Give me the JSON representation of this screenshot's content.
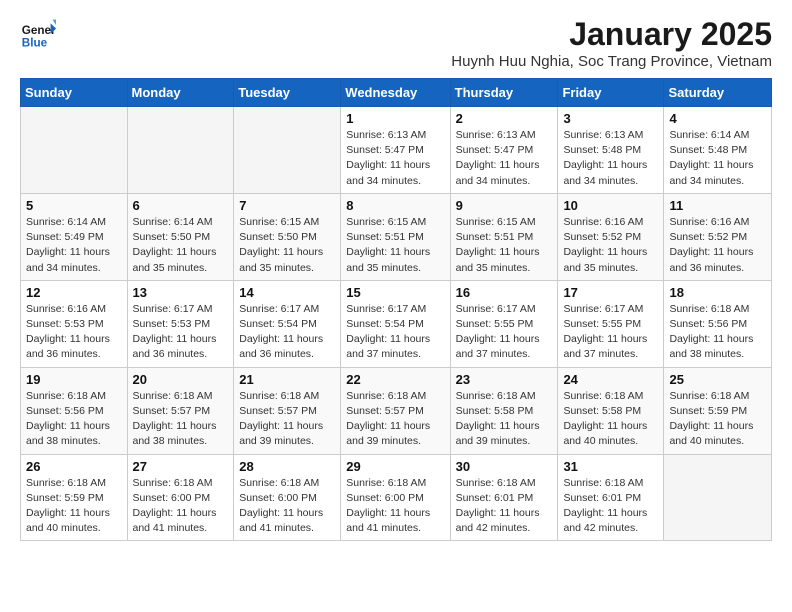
{
  "header": {
    "logo_line1": "General",
    "logo_line2": "Blue",
    "month": "January 2025",
    "location": "Huynh Huu Nghia, Soc Trang Province, Vietnam"
  },
  "days_of_week": [
    "Sunday",
    "Monday",
    "Tuesday",
    "Wednesday",
    "Thursday",
    "Friday",
    "Saturday"
  ],
  "weeks": [
    [
      {
        "day": "",
        "info": ""
      },
      {
        "day": "",
        "info": ""
      },
      {
        "day": "",
        "info": ""
      },
      {
        "day": "1",
        "info": "Sunrise: 6:13 AM\nSunset: 5:47 PM\nDaylight: 11 hours and 34 minutes."
      },
      {
        "day": "2",
        "info": "Sunrise: 6:13 AM\nSunset: 5:47 PM\nDaylight: 11 hours and 34 minutes."
      },
      {
        "day": "3",
        "info": "Sunrise: 6:13 AM\nSunset: 5:48 PM\nDaylight: 11 hours and 34 minutes."
      },
      {
        "day": "4",
        "info": "Sunrise: 6:14 AM\nSunset: 5:48 PM\nDaylight: 11 hours and 34 minutes."
      }
    ],
    [
      {
        "day": "5",
        "info": "Sunrise: 6:14 AM\nSunset: 5:49 PM\nDaylight: 11 hours and 34 minutes."
      },
      {
        "day": "6",
        "info": "Sunrise: 6:14 AM\nSunset: 5:50 PM\nDaylight: 11 hours and 35 minutes."
      },
      {
        "day": "7",
        "info": "Sunrise: 6:15 AM\nSunset: 5:50 PM\nDaylight: 11 hours and 35 minutes."
      },
      {
        "day": "8",
        "info": "Sunrise: 6:15 AM\nSunset: 5:51 PM\nDaylight: 11 hours and 35 minutes."
      },
      {
        "day": "9",
        "info": "Sunrise: 6:15 AM\nSunset: 5:51 PM\nDaylight: 11 hours and 35 minutes."
      },
      {
        "day": "10",
        "info": "Sunrise: 6:16 AM\nSunset: 5:52 PM\nDaylight: 11 hours and 35 minutes."
      },
      {
        "day": "11",
        "info": "Sunrise: 6:16 AM\nSunset: 5:52 PM\nDaylight: 11 hours and 36 minutes."
      }
    ],
    [
      {
        "day": "12",
        "info": "Sunrise: 6:16 AM\nSunset: 5:53 PM\nDaylight: 11 hours and 36 minutes."
      },
      {
        "day": "13",
        "info": "Sunrise: 6:17 AM\nSunset: 5:53 PM\nDaylight: 11 hours and 36 minutes."
      },
      {
        "day": "14",
        "info": "Sunrise: 6:17 AM\nSunset: 5:54 PM\nDaylight: 11 hours and 36 minutes."
      },
      {
        "day": "15",
        "info": "Sunrise: 6:17 AM\nSunset: 5:54 PM\nDaylight: 11 hours and 37 minutes."
      },
      {
        "day": "16",
        "info": "Sunrise: 6:17 AM\nSunset: 5:55 PM\nDaylight: 11 hours and 37 minutes."
      },
      {
        "day": "17",
        "info": "Sunrise: 6:17 AM\nSunset: 5:55 PM\nDaylight: 11 hours and 37 minutes."
      },
      {
        "day": "18",
        "info": "Sunrise: 6:18 AM\nSunset: 5:56 PM\nDaylight: 11 hours and 38 minutes."
      }
    ],
    [
      {
        "day": "19",
        "info": "Sunrise: 6:18 AM\nSunset: 5:56 PM\nDaylight: 11 hours and 38 minutes."
      },
      {
        "day": "20",
        "info": "Sunrise: 6:18 AM\nSunset: 5:57 PM\nDaylight: 11 hours and 38 minutes."
      },
      {
        "day": "21",
        "info": "Sunrise: 6:18 AM\nSunset: 5:57 PM\nDaylight: 11 hours and 39 minutes."
      },
      {
        "day": "22",
        "info": "Sunrise: 6:18 AM\nSunset: 5:57 PM\nDaylight: 11 hours and 39 minutes."
      },
      {
        "day": "23",
        "info": "Sunrise: 6:18 AM\nSunset: 5:58 PM\nDaylight: 11 hours and 39 minutes."
      },
      {
        "day": "24",
        "info": "Sunrise: 6:18 AM\nSunset: 5:58 PM\nDaylight: 11 hours and 40 minutes."
      },
      {
        "day": "25",
        "info": "Sunrise: 6:18 AM\nSunset: 5:59 PM\nDaylight: 11 hours and 40 minutes."
      }
    ],
    [
      {
        "day": "26",
        "info": "Sunrise: 6:18 AM\nSunset: 5:59 PM\nDaylight: 11 hours and 40 minutes."
      },
      {
        "day": "27",
        "info": "Sunrise: 6:18 AM\nSunset: 6:00 PM\nDaylight: 11 hours and 41 minutes."
      },
      {
        "day": "28",
        "info": "Sunrise: 6:18 AM\nSunset: 6:00 PM\nDaylight: 11 hours and 41 minutes."
      },
      {
        "day": "29",
        "info": "Sunrise: 6:18 AM\nSunset: 6:00 PM\nDaylight: 11 hours and 41 minutes."
      },
      {
        "day": "30",
        "info": "Sunrise: 6:18 AM\nSunset: 6:01 PM\nDaylight: 11 hours and 42 minutes."
      },
      {
        "day": "31",
        "info": "Sunrise: 6:18 AM\nSunset: 6:01 PM\nDaylight: 11 hours and 42 minutes."
      },
      {
        "day": "",
        "info": ""
      }
    ]
  ]
}
